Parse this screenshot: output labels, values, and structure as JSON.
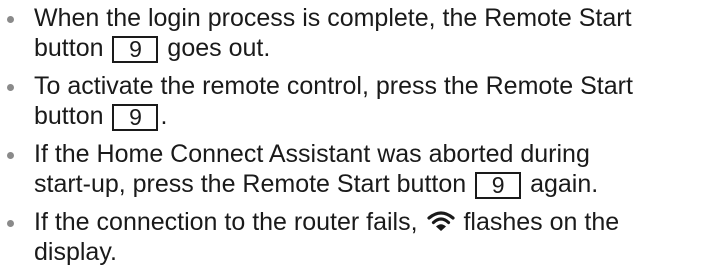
{
  "items": [
    {
      "line1": "When the login process is complete, the Remote Start",
      "pre_key": "button",
      "key": "9",
      "post_key": "goes out."
    },
    {
      "line1": "To activate the remote control, press the Remote Start",
      "pre_key": "button",
      "key": "9",
      "post_key": "."
    },
    {
      "line1": "If the Home Connect Assistant was aborted during",
      "pre_key": "start-up, press the Remote Start button",
      "key": "9",
      "post_key": "again."
    },
    {
      "pre_icon": "If the connection to the router fails,",
      "icon": "wifi-icon",
      "post_icon": "flashes on the",
      "line2": "display."
    }
  ]
}
